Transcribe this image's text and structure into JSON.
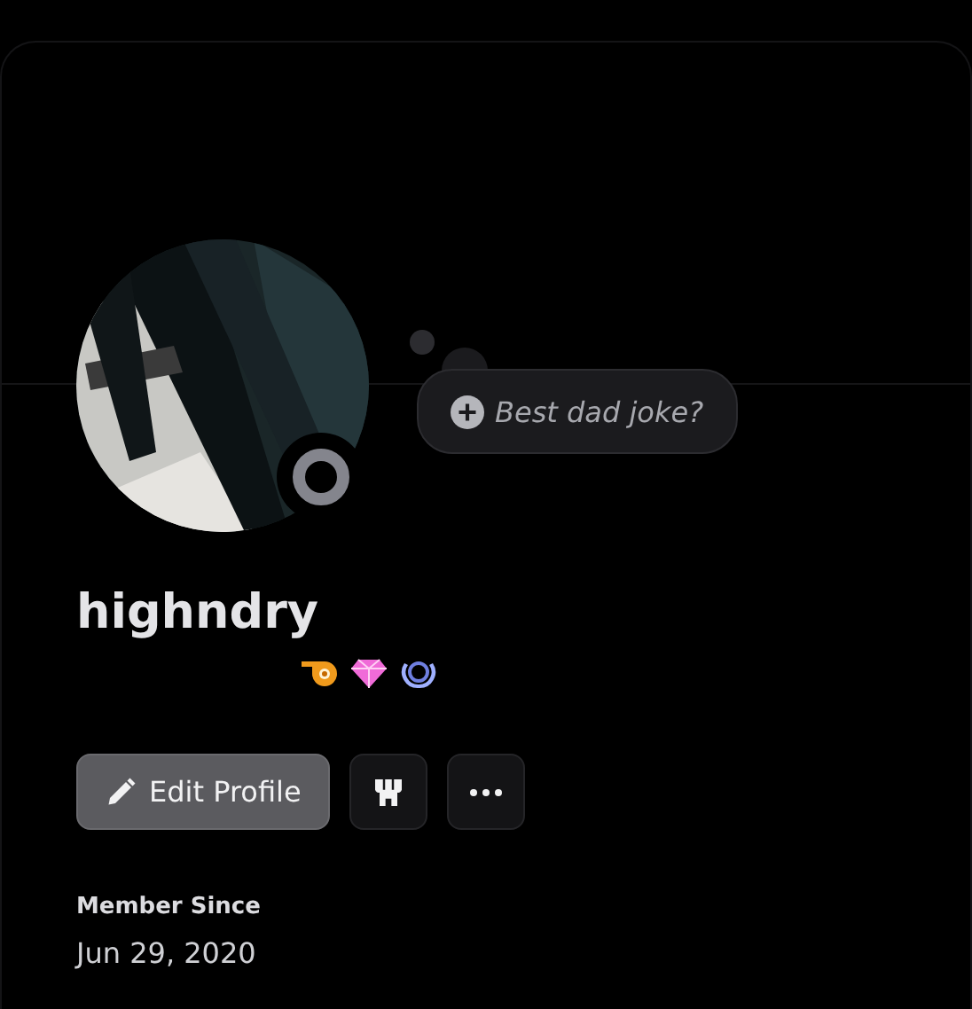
{
  "profile": {
    "username": "highndry",
    "online": false
  },
  "custom_status": {
    "placeholder": "Best dad joke?"
  },
  "badges": [
    {
      "kind": "boost"
    },
    {
      "kind": "gem"
    },
    {
      "kind": "laurel"
    }
  ],
  "buttons": [
    {
      "kind": "edit",
      "label": "Edit Profile"
    },
    {
      "kind": "shop"
    },
    {
      "kind": "more"
    }
  ],
  "member_since": {
    "label": "Member Since",
    "date": "Jun 29, 2020"
  }
}
